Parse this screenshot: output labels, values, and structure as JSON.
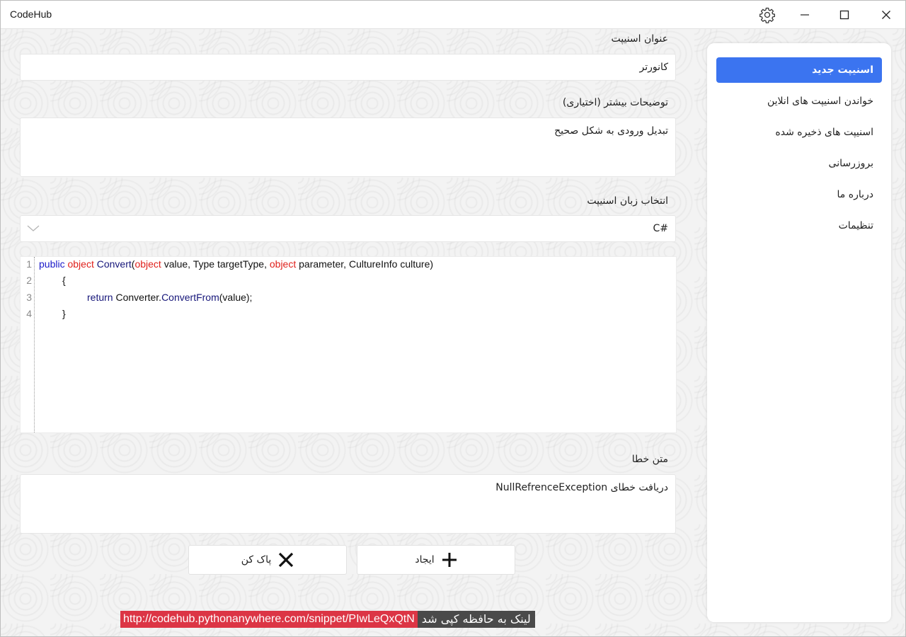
{
  "window": {
    "title": "CodeHub"
  },
  "sidebar": {
    "items": [
      {
        "label": "اسنیپت جدید",
        "active": true
      },
      {
        "label": "خواندن اسنیپت های انلاین",
        "active": false
      },
      {
        "label": "اسنیپت های ذخیره شده",
        "active": false
      },
      {
        "label": "بروزرسانی",
        "active": false
      },
      {
        "label": "درباره ما",
        "active": false
      },
      {
        "label": "تنظیمات",
        "active": false
      }
    ]
  },
  "form": {
    "title_label": "عنوان اسنیپت",
    "title_value": "کانورتر",
    "description_label": "توضیحات بیشتر (اختیاری)",
    "description_value": "تبدیل ورودی به شکل صحیح",
    "language_label": "انتخاب زبان اسنیپت",
    "language_value": "C#",
    "error_label": "متن خطا",
    "error_value": "دریافت خطای NullRefrenceException"
  },
  "code": {
    "line_numbers": [
      "1",
      "2",
      "3",
      "4"
    ],
    "lines": [
      "public object Convert(object value, Type targetType, object parameter, CultureInfo culture)",
      "        {",
      "            return Converter.ConvertFrom(value);",
      "        }"
    ]
  },
  "buttons": {
    "create_label": "ایجاد",
    "clear_label": "پاک کن"
  },
  "toast": {
    "message": "لینک به حافظه کپی شد",
    "url": "http://codehub.pythonanywhere.com/snippet/PIwLeQxQtN"
  },
  "colors": {
    "accent": "#3b74f0",
    "toast_url_bg": "#dc3545",
    "toast_msg_bg": "#4a4a4a"
  }
}
